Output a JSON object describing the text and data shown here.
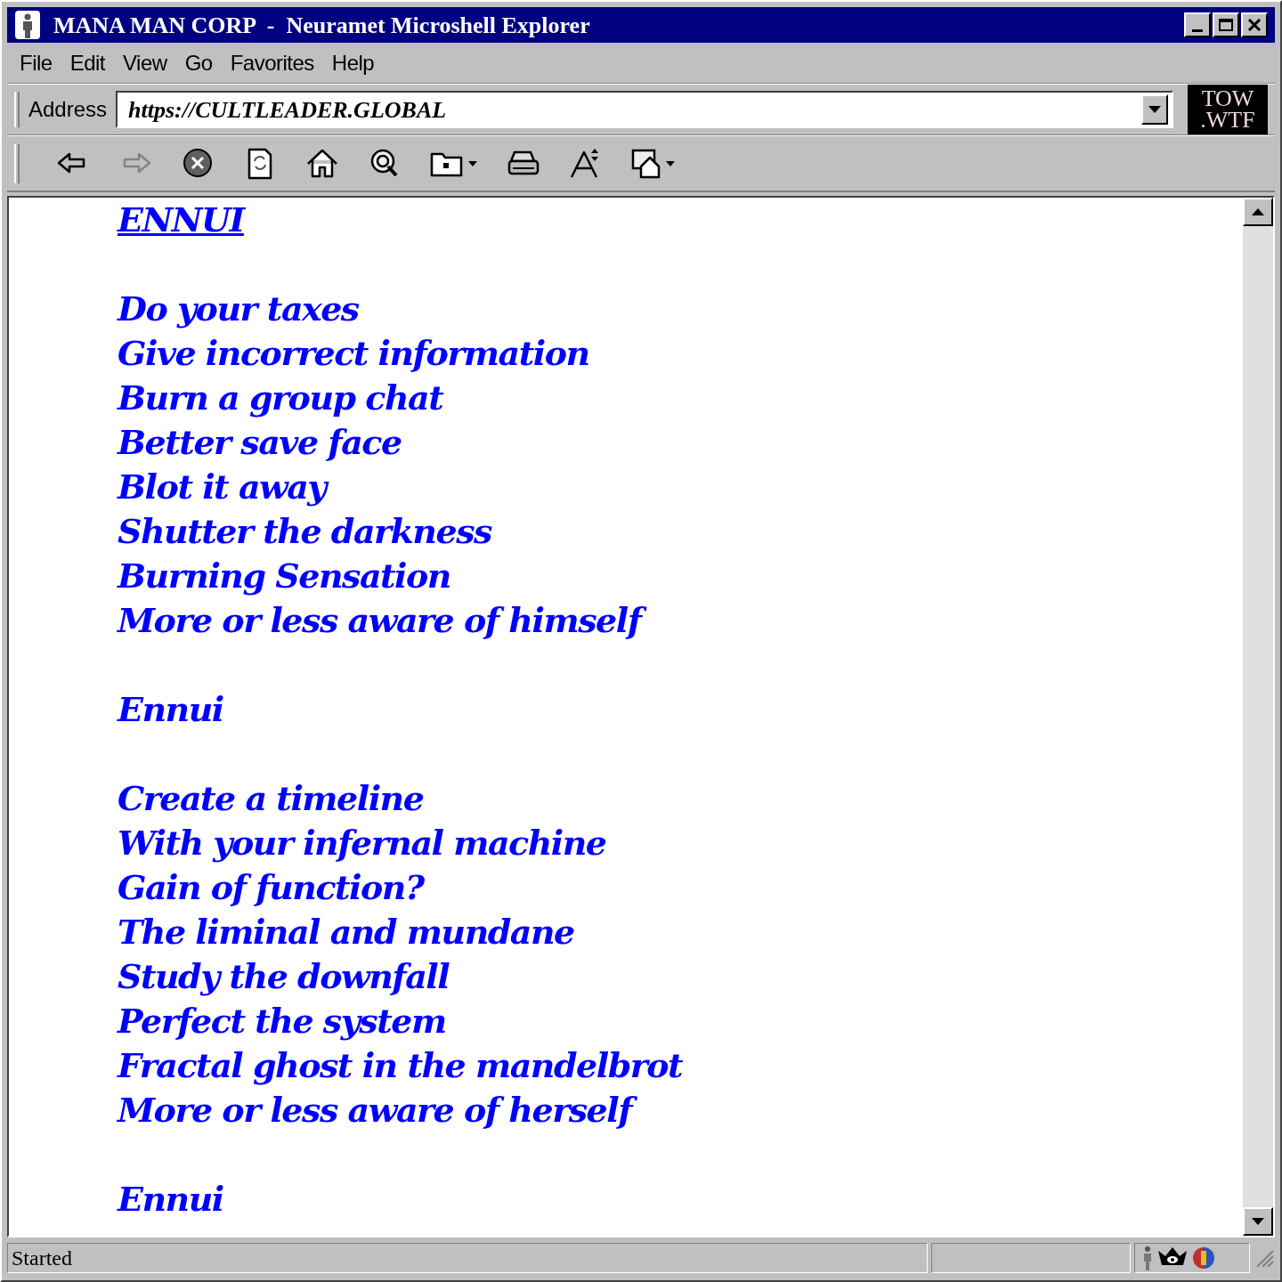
{
  "window": {
    "title": "MANA MAN CORP  -  Neuramet Microshell Explorer"
  },
  "menu": [
    "File",
    "Edit",
    "View",
    "Go",
    "Favorites",
    "Help"
  ],
  "address": {
    "label": "Address",
    "value": "https://CULTLEADER.GLOBAL"
  },
  "logo": {
    "lines": [
      "TOW",
      ".WTF"
    ]
  },
  "toolbar": [
    {
      "kind": "back",
      "disabled": false
    },
    {
      "kind": "forward",
      "disabled": true
    },
    {
      "kind": "stop",
      "disabled": false
    },
    {
      "kind": "refresh",
      "disabled": false
    },
    {
      "kind": "home",
      "disabled": false
    },
    {
      "kind": "search",
      "disabled": false
    },
    {
      "kind": "favorites",
      "disabled": false
    },
    {
      "kind": "print",
      "disabled": false
    },
    {
      "kind": "font",
      "disabled": false
    },
    {
      "kind": "mail",
      "disabled": false
    }
  ],
  "stanzas": [
    {
      "kind": "heading",
      "lines": [
        "ENNUI"
      ]
    },
    {
      "kind": "verse",
      "lines": [
        "Do your taxes",
        "Give incorrect information",
        "Burn a group chat",
        "Better save face",
        "Blot it away",
        "Shutter the darkness",
        "Burning Sensation",
        "More or less aware of himself"
      ]
    },
    {
      "kind": "refrain",
      "lines": [
        "Ennui"
      ]
    },
    {
      "kind": "verse",
      "lines": [
        "Create a timeline",
        "With your infernal machine",
        "Gain of function?",
        "The liminal and mundane",
        "Study the downfall",
        "Perfect the system",
        "Fractal ghost in the mandelbrot",
        "More or less aware of herself"
      ]
    },
    {
      "kind": "refrain",
      "lines": [
        "Ennui"
      ]
    }
  ],
  "status_bar": {
    "text": "Started"
  }
}
